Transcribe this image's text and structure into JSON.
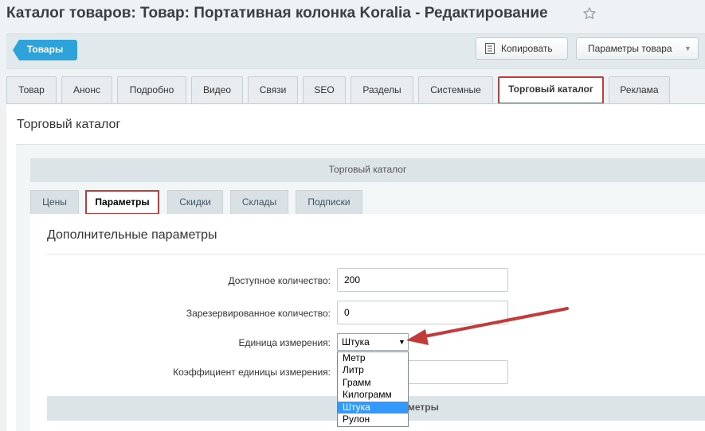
{
  "header": {
    "title": "Каталог товаров: Товар: Портативная колонка Koralia - Редактирование",
    "star_icon": "star-icon"
  },
  "toolbar": {
    "back_label": "Товары",
    "copy_label": "Копировать",
    "params_label": "Параметры товара",
    "accent": "#2ea3d9"
  },
  "tabs": [
    {
      "label": "Товар"
    },
    {
      "label": "Анонс"
    },
    {
      "label": "Подробно"
    },
    {
      "label": "Видео"
    },
    {
      "label": "Связи"
    },
    {
      "label": "SEO"
    },
    {
      "label": "Разделы"
    },
    {
      "label": "Системные"
    },
    {
      "label": "Торговый каталог",
      "active": true
    },
    {
      "label": "Реклама"
    }
  ],
  "panel": {
    "title": "Торговый каталог",
    "inner_title": "Торговый каталог"
  },
  "subtabs": [
    {
      "label": "Цены"
    },
    {
      "label": "Параметры",
      "active": true
    },
    {
      "label": "Скидки"
    },
    {
      "label": "Склады"
    },
    {
      "label": "Подписки"
    }
  ],
  "params": {
    "section_title": "Дополнительные параметры",
    "available_label": "Доступное количество:",
    "available_value": "200",
    "reserved_label": "Зарезервированное количество:",
    "reserved_value": "0",
    "unit_label": "Единица измерения:",
    "unit_value": "Штука",
    "unit_options": [
      "Метр",
      "Литр",
      "Грамм",
      "Килограмм",
      "Штука",
      "Рулон"
    ],
    "coef_label": "Коэффициент единицы измерения:",
    "coef_value": "",
    "bottom_bar_text": "метры"
  },
  "colors": {
    "highlight": "#c23b3b",
    "selection": "#3399ff"
  }
}
